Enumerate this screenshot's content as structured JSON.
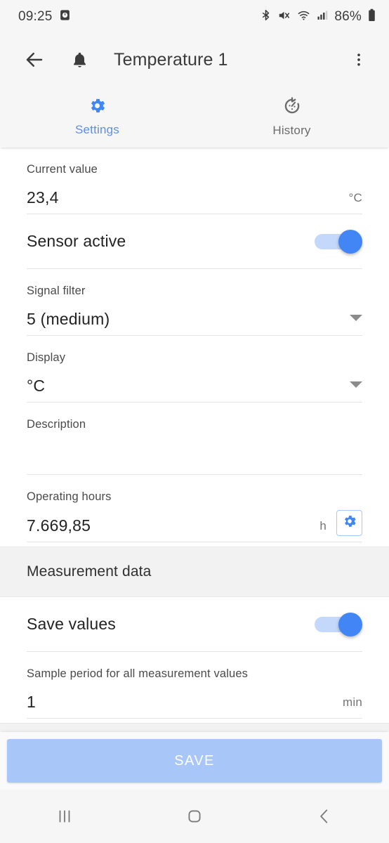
{
  "status_bar": {
    "time": "09:25",
    "battery_percent": "86%",
    "icons": [
      "alarm-icon",
      "bluetooth-icon",
      "mute-icon",
      "wifi-icon",
      "cellular-signal-icon",
      "battery-icon"
    ]
  },
  "app_bar": {
    "back_icon": "back-arrow-icon",
    "bell_icon": "bell-icon",
    "title": "Temperature 1",
    "overflow_icon": "more-vertical-icon"
  },
  "tabs": [
    {
      "label": "Settings",
      "icon": "gear-icon",
      "active": true
    },
    {
      "label": "History",
      "icon": "history-timer-icon",
      "active": false
    }
  ],
  "fields": {
    "current_value": {
      "label": "Current value",
      "value": "23,4",
      "unit": "°C"
    },
    "sensor_active": {
      "label": "Sensor active",
      "state": "on"
    },
    "signal_filter": {
      "label": "Signal filter",
      "value": "5 (medium)"
    },
    "display": {
      "label": "Display",
      "value": "°C"
    },
    "description": {
      "label": "Description",
      "value": ""
    },
    "operating_hours": {
      "label": "Operating hours",
      "value": "7.669,85",
      "unit": "h",
      "action_icon": "gear-icon"
    }
  },
  "measurement_section": {
    "title": "Measurement data",
    "save_values": {
      "label": "Save values",
      "state": "on"
    },
    "sample_period": {
      "label": "Sample period for all measurement values",
      "value": "1",
      "unit": "min"
    }
  },
  "save_bar": {
    "label": "SAVE"
  },
  "nav_bar": {
    "recents_icon": "recents-icon",
    "home_icon": "home-icon",
    "back_icon": "back-chevron-icon"
  },
  "colors": {
    "accent": "#4285f4",
    "tab_active": "#5e8ee8",
    "save_button": "#a8c7f8",
    "track": "#c3d8fb"
  }
}
